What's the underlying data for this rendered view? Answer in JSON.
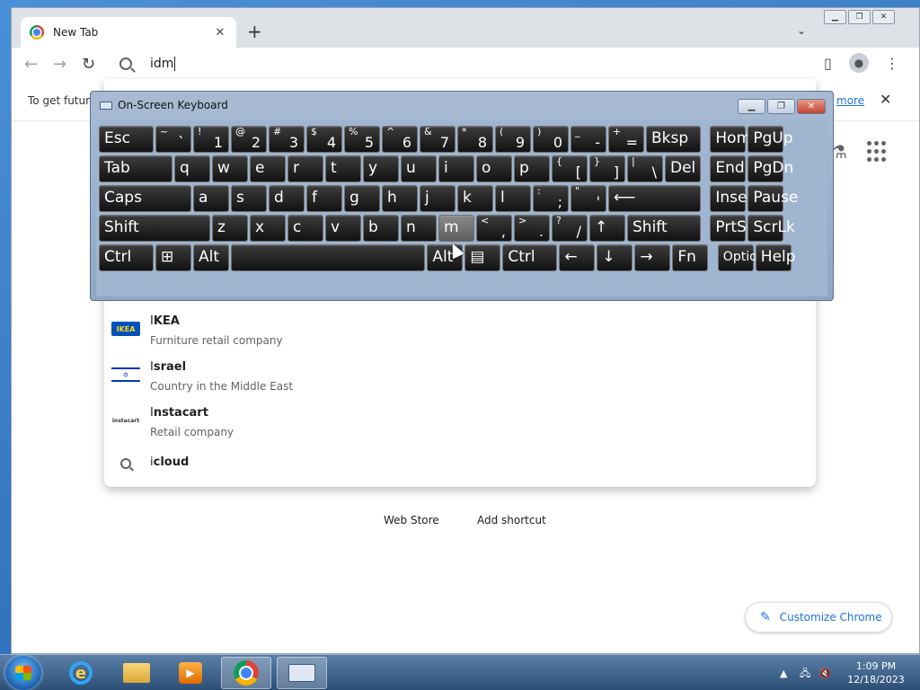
{
  "browser": {
    "tab_title": "New Tab",
    "new_tab": "+",
    "omnibox_value": "idm",
    "infobar_text": "To get future",
    "infobar_link": "more",
    "infobar_close": "✕",
    "shortcuts": [
      "Web Store",
      "Add shortcut"
    ],
    "customize_label": "Customize Chrome"
  },
  "suggestions": [
    {
      "prefix": "I",
      "rest": "KEA",
      "subtitle": "Furniture retail company",
      "icon": "ikea-logo"
    },
    {
      "prefix": "I",
      "rest": "srael",
      "subtitle": "Country in the Middle East",
      "icon": "israel-flag"
    },
    {
      "prefix": "I",
      "rest": "nstacart",
      "subtitle": "Retail company",
      "icon": "instacart-logo"
    },
    {
      "prefix": "i",
      "rest": "cloud",
      "subtitle": "",
      "icon": "search-icon"
    }
  ],
  "suggestion_icon_text": {
    "ikea": "IKEA",
    "israel": "✡",
    "instacart": "instacart"
  },
  "osk": {
    "title": "On-Screen Keyboard",
    "rows": [
      [
        {
          "main": "Esc",
          "w": 1.5
        },
        {
          "sm": "~",
          "big": "`"
        },
        {
          "sm": "!",
          "big": "1"
        },
        {
          "sm": "@",
          "big": "2"
        },
        {
          "sm": "#",
          "big": "3"
        },
        {
          "sm": "$",
          "big": "4"
        },
        {
          "sm": "%",
          "big": "5"
        },
        {
          "sm": "^",
          "big": "6"
        },
        {
          "sm": "&",
          "big": "7"
        },
        {
          "sm": "*",
          "big": "8"
        },
        {
          "sm": "(",
          "big": "9"
        },
        {
          "sm": ")",
          "big": "0"
        },
        {
          "sm": "_",
          "big": "-"
        },
        {
          "sm": "+",
          "big": "="
        },
        {
          "main": "Bksp",
          "w": 1.5
        },
        {
          "gap": 0.2
        },
        {
          "main": "Home"
        },
        {
          "main": "PgUp"
        }
      ],
      [
        {
          "main": "Tab",
          "w": 2
        },
        {
          "main": "q"
        },
        {
          "main": "w"
        },
        {
          "main": "e"
        },
        {
          "main": "r"
        },
        {
          "main": "t"
        },
        {
          "main": "y"
        },
        {
          "main": "u"
        },
        {
          "main": "i"
        },
        {
          "main": "o"
        },
        {
          "main": "p"
        },
        {
          "sm": "{",
          "big": "["
        },
        {
          "sm": "}",
          "big": "]"
        },
        {
          "sm": "|",
          "big": "\\"
        },
        {
          "main": "Del"
        },
        {
          "gap": 0.2
        },
        {
          "main": "End"
        },
        {
          "main": "PgDn"
        }
      ],
      [
        {
          "main": "Caps",
          "w": 2.5
        },
        {
          "main": "a"
        },
        {
          "main": "s"
        },
        {
          "main": "d"
        },
        {
          "main": "f"
        },
        {
          "main": "g"
        },
        {
          "main": "h"
        },
        {
          "main": "j"
        },
        {
          "main": "k"
        },
        {
          "main": "l"
        },
        {
          "sm": ":",
          "big": ";"
        },
        {
          "sm": "\"",
          "big": "'"
        },
        {
          "main": "⟵",
          "w": 2.5
        },
        {
          "gap": 0.2
        },
        {
          "main": "Insert"
        },
        {
          "main": "Pause"
        }
      ],
      [
        {
          "main": "Shift",
          "w": 3
        },
        {
          "main": "z"
        },
        {
          "main": "x"
        },
        {
          "main": "c"
        },
        {
          "main": "v"
        },
        {
          "main": "b"
        },
        {
          "main": "n"
        },
        {
          "main": "m",
          "hl": true
        },
        {
          "sm": "<",
          "big": ","
        },
        {
          "sm": ">",
          "big": "."
        },
        {
          "sm": "?",
          "big": "/"
        },
        {
          "main": "↑"
        },
        {
          "main": "Shift",
          "w": 2
        },
        {
          "gap": 0.2
        },
        {
          "main": "PrtScn"
        },
        {
          "main": "ScrLk"
        }
      ],
      [
        {
          "main": "Ctrl",
          "w": 1.5
        },
        {
          "main": "⊞"
        },
        {
          "main": "Alt"
        },
        {
          "main": "",
          "w": 5.2
        },
        {
          "main": "Alt"
        },
        {
          "main": "▤"
        },
        {
          "main": "Ctrl",
          "w": 1.5
        },
        {
          "main": "←"
        },
        {
          "main": "↓"
        },
        {
          "main": "→"
        },
        {
          "main": "Fn"
        },
        {
          "gap": 0.2
        },
        {
          "main": "Options",
          "opt": true
        },
        {
          "main": "Help"
        }
      ]
    ]
  },
  "taskbar": {
    "time": "1:09 PM",
    "date": "12/18/2023"
  }
}
